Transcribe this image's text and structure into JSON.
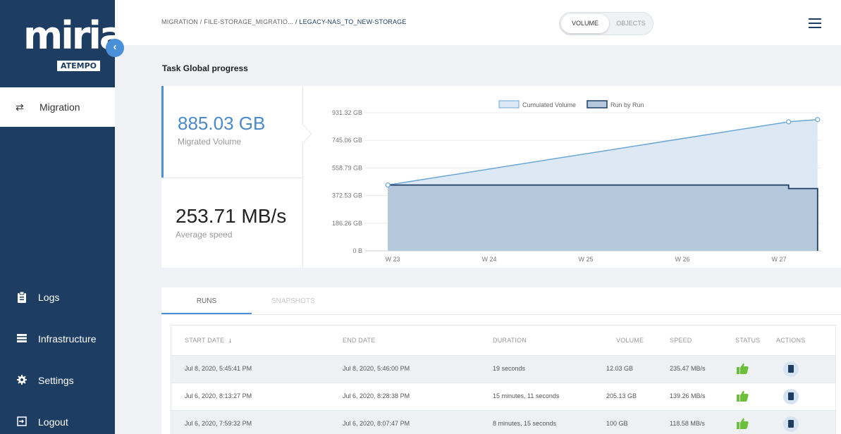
{
  "app": {
    "logo_main": "miria",
    "logo_sub": "ATEMPO",
    "collapse_icon": "chevron-left-icon"
  },
  "sidebar": {
    "items": [
      {
        "label": "Migration",
        "icon": "swap-arrows-icon",
        "active": true
      },
      {
        "label": "Logs",
        "icon": "clipboard-icon"
      },
      {
        "label": "Infrastructure",
        "icon": "server-list-icon"
      },
      {
        "label": "Settings",
        "icon": "gear-icon"
      },
      {
        "label": "Logout",
        "icon": "logout-icon"
      }
    ]
  },
  "header": {
    "breadcrumb": [
      "MIGRATION",
      "FILE-STORAGE_MIGRATIO...",
      "LEGACY-NAS_TO_NEW-STORAGE"
    ],
    "toggle": {
      "on": "VOLUME",
      "off": "OBJECTS"
    },
    "menu_icon": "hamburger-icon"
  },
  "progress": {
    "title": "Task Global progress",
    "migrated_value": "885.03 GB",
    "migrated_label": "Migrated Volume",
    "speed_value": "253.71 MB/s",
    "speed_label": "Average speed"
  },
  "chart_data": {
    "type": "area",
    "legend": [
      "Cumulated Volume",
      "Run by Run"
    ],
    "legend_position": "top",
    "y_ticks": [
      "931.32 GB",
      "745.06 GB",
      "558.79 GB",
      "372.53 GB",
      "186.26 GB",
      "0 B"
    ],
    "x_ticks": [
      "W 23",
      "W 24",
      "W 25",
      "W 26",
      "W 27"
    ],
    "ylim_gb": [
      0,
      931.32
    ],
    "series": [
      {
        "name": "Cumulated Volume",
        "x": [
          22.95,
          27.1,
          27.4
        ],
        "y": [
          444,
          870,
          885
        ]
      },
      {
        "name": "Run by Run",
        "x": [
          22.95,
          27.1,
          27.1,
          27.4,
          27.4
        ],
        "y": [
          444,
          444,
          420,
          420,
          0
        ]
      }
    ],
    "colors": {
      "cumulated": "#6aa6d6",
      "run": "#1d3d63"
    }
  },
  "runs": {
    "tabs": [
      "RUNS",
      "SNAPSHOTS"
    ],
    "columns": [
      "START DATE",
      "END DATE",
      "DURATION",
      "VOLUME",
      "SPEED",
      "STATUS",
      "ACTIONS"
    ],
    "sort_icon": "arrow-down-icon",
    "rows": [
      {
        "start": "Jul 8, 2020, 5:45:41 PM",
        "end": "Jul 8, 2020, 5:46:00 PM",
        "duration": "19 seconds",
        "volume": "12.03 GB",
        "speed": "235.47 MB/s",
        "status": "thumbs-up-icon",
        "action": "clipboard-icon"
      },
      {
        "start": "Jul 6, 2020, 8:13:27 PM",
        "end": "Jul 6, 2020, 8:28:38 PM",
        "duration": "15 minutes, 11 seconds",
        "volume": "205.13 GB",
        "speed": "139.26 MB/s",
        "status": "thumbs-up-icon",
        "action": "clipboard-icon"
      },
      {
        "start": "Jul 6, 2020, 7:59:32 PM",
        "end": "Jul 6, 2020, 8:07:47 PM",
        "duration": "8 minutes, 15 seconds",
        "volume": "100 GB",
        "speed": "118.58 MB/s",
        "status": "thumbs-up-icon",
        "action": "clipboard-icon"
      }
    ],
    "colors": {
      "status_ok": "#6cbf3a",
      "accent": "#4a90d9"
    }
  }
}
